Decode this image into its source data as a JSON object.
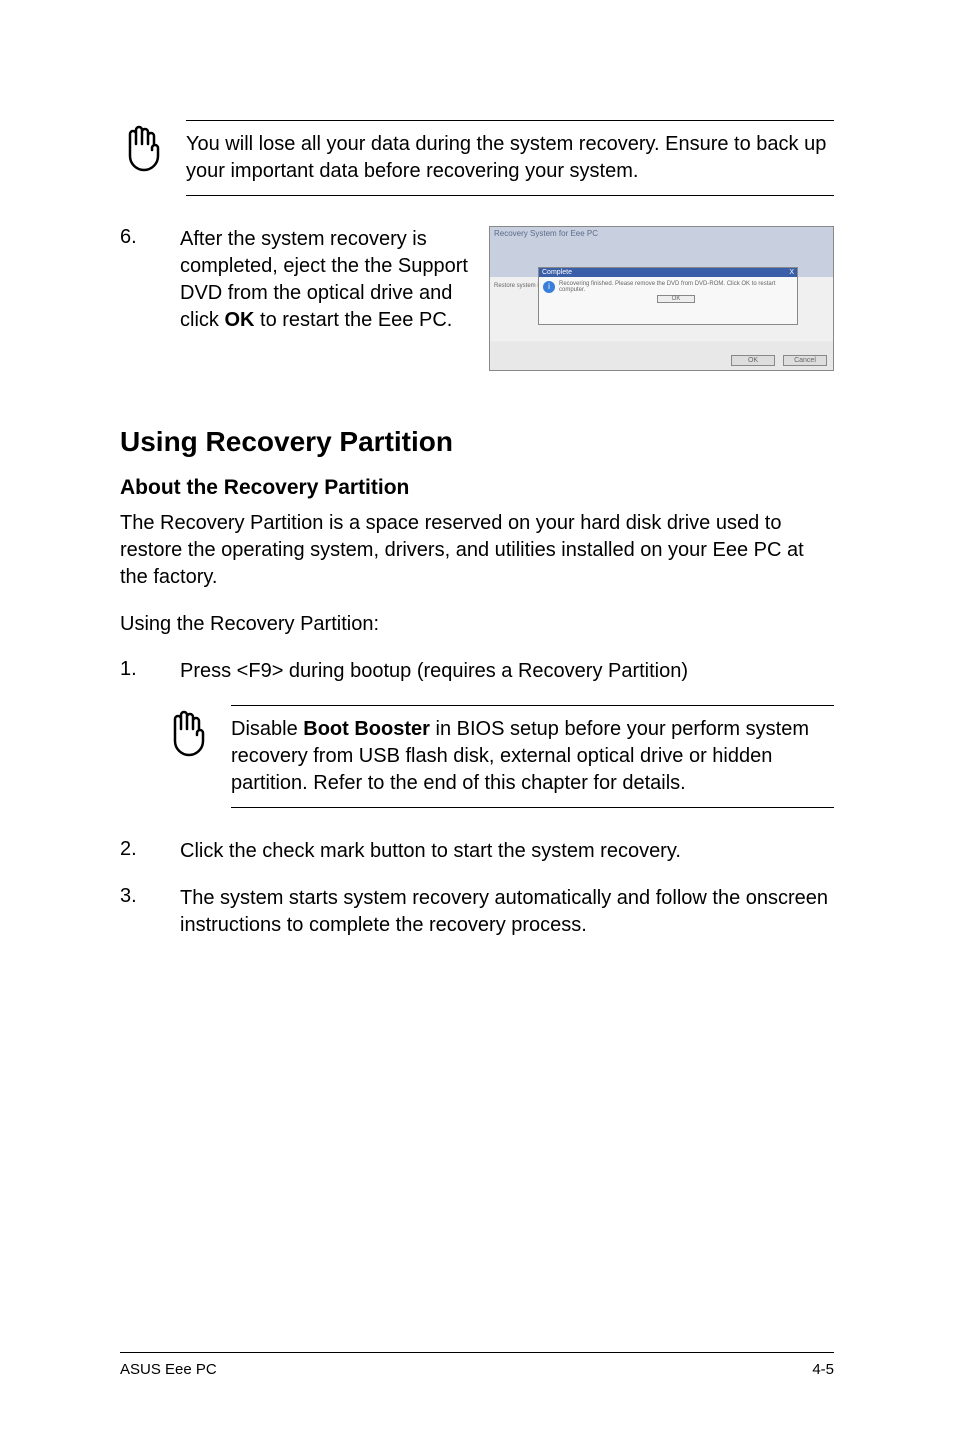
{
  "note1": {
    "text_a": "You will lose all your data during the system recovery. Ensure to back up your important data before recovering your system."
  },
  "step6": {
    "num": "6.",
    "text_a": "After the system recovery is completed, eject the the Support DVD from the optical drive and click ",
    "bold": "OK",
    "text_b": " to restart the Eee PC."
  },
  "screenshot": {
    "window_title": "Recovery System for Eee PC",
    "dlg_title": "Complete",
    "dlg_close": "X",
    "dlg_msg": "Recovering finished. Please remove the DVD from DVD-ROM. Click OK to restart computer.",
    "dlg_ok": "OK",
    "side_label": "Restore system ima",
    "btn_ok": "OK",
    "btn_cancel": "Cancel",
    "info_glyph": "i"
  },
  "section": {
    "title": "Using Recovery Partition",
    "subtitle": "About the Recovery Partition",
    "para1": "The Recovery Partition is a space reserved on your hard disk drive used to restore the operating system, drivers, and utilities installed on your Eee PC at the factory.",
    "para2": "Using the Recovery Partition:"
  },
  "step1": {
    "num": "1.",
    "text": "Press <F9> during bootup (requires a Recovery Partition)"
  },
  "note2": {
    "text_a": "Disable ",
    "bold": "Boot Booster",
    "text_b": " in BIOS setup before your perform system recovery from USB flash disk, external optical drive or hidden partition. Refer to the end of this chapter for details."
  },
  "step2": {
    "num": "2.",
    "text": "Click the check mark button to start the system recovery."
  },
  "step3": {
    "num": "3.",
    "text": "The system starts system recovery automatically and follow the onscreen instructions to complete the recovery process."
  },
  "footer": {
    "left": "ASUS Eee PC",
    "right": "4-5"
  }
}
